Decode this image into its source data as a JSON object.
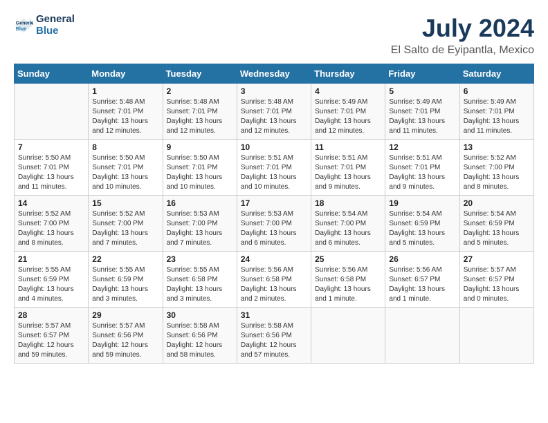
{
  "header": {
    "logo_line1": "General",
    "logo_line2": "Blue",
    "month": "July 2024",
    "location": "El Salto de Eyipantla, Mexico"
  },
  "weekdays": [
    "Sunday",
    "Monday",
    "Tuesday",
    "Wednesday",
    "Thursday",
    "Friday",
    "Saturday"
  ],
  "weeks": [
    [
      {
        "day": "",
        "info": ""
      },
      {
        "day": "1",
        "info": "Sunrise: 5:48 AM\nSunset: 7:01 PM\nDaylight: 13 hours\nand 12 minutes."
      },
      {
        "day": "2",
        "info": "Sunrise: 5:48 AM\nSunset: 7:01 PM\nDaylight: 13 hours\nand 12 minutes."
      },
      {
        "day": "3",
        "info": "Sunrise: 5:48 AM\nSunset: 7:01 PM\nDaylight: 13 hours\nand 12 minutes."
      },
      {
        "day": "4",
        "info": "Sunrise: 5:49 AM\nSunset: 7:01 PM\nDaylight: 13 hours\nand 12 minutes."
      },
      {
        "day": "5",
        "info": "Sunrise: 5:49 AM\nSunset: 7:01 PM\nDaylight: 13 hours\nand 11 minutes."
      },
      {
        "day": "6",
        "info": "Sunrise: 5:49 AM\nSunset: 7:01 PM\nDaylight: 13 hours\nand 11 minutes."
      }
    ],
    [
      {
        "day": "7",
        "info": "Sunrise: 5:50 AM\nSunset: 7:01 PM\nDaylight: 13 hours\nand 11 minutes."
      },
      {
        "day": "8",
        "info": "Sunrise: 5:50 AM\nSunset: 7:01 PM\nDaylight: 13 hours\nand 10 minutes."
      },
      {
        "day": "9",
        "info": "Sunrise: 5:50 AM\nSunset: 7:01 PM\nDaylight: 13 hours\nand 10 minutes."
      },
      {
        "day": "10",
        "info": "Sunrise: 5:51 AM\nSunset: 7:01 PM\nDaylight: 13 hours\nand 10 minutes."
      },
      {
        "day": "11",
        "info": "Sunrise: 5:51 AM\nSunset: 7:01 PM\nDaylight: 13 hours\nand 9 minutes."
      },
      {
        "day": "12",
        "info": "Sunrise: 5:51 AM\nSunset: 7:01 PM\nDaylight: 13 hours\nand 9 minutes."
      },
      {
        "day": "13",
        "info": "Sunrise: 5:52 AM\nSunset: 7:00 PM\nDaylight: 13 hours\nand 8 minutes."
      }
    ],
    [
      {
        "day": "14",
        "info": "Sunrise: 5:52 AM\nSunset: 7:00 PM\nDaylight: 13 hours\nand 8 minutes."
      },
      {
        "day": "15",
        "info": "Sunrise: 5:52 AM\nSunset: 7:00 PM\nDaylight: 13 hours\nand 7 minutes."
      },
      {
        "day": "16",
        "info": "Sunrise: 5:53 AM\nSunset: 7:00 PM\nDaylight: 13 hours\nand 7 minutes."
      },
      {
        "day": "17",
        "info": "Sunrise: 5:53 AM\nSunset: 7:00 PM\nDaylight: 13 hours\nand 6 minutes."
      },
      {
        "day": "18",
        "info": "Sunrise: 5:54 AM\nSunset: 7:00 PM\nDaylight: 13 hours\nand 6 minutes."
      },
      {
        "day": "19",
        "info": "Sunrise: 5:54 AM\nSunset: 6:59 PM\nDaylight: 13 hours\nand 5 minutes."
      },
      {
        "day": "20",
        "info": "Sunrise: 5:54 AM\nSunset: 6:59 PM\nDaylight: 13 hours\nand 5 minutes."
      }
    ],
    [
      {
        "day": "21",
        "info": "Sunrise: 5:55 AM\nSunset: 6:59 PM\nDaylight: 13 hours\nand 4 minutes."
      },
      {
        "day": "22",
        "info": "Sunrise: 5:55 AM\nSunset: 6:59 PM\nDaylight: 13 hours\nand 3 minutes."
      },
      {
        "day": "23",
        "info": "Sunrise: 5:55 AM\nSunset: 6:58 PM\nDaylight: 13 hours\nand 3 minutes."
      },
      {
        "day": "24",
        "info": "Sunrise: 5:56 AM\nSunset: 6:58 PM\nDaylight: 13 hours\nand 2 minutes."
      },
      {
        "day": "25",
        "info": "Sunrise: 5:56 AM\nSunset: 6:58 PM\nDaylight: 13 hours\nand 1 minute."
      },
      {
        "day": "26",
        "info": "Sunrise: 5:56 AM\nSunset: 6:57 PM\nDaylight: 13 hours\nand 1 minute."
      },
      {
        "day": "27",
        "info": "Sunrise: 5:57 AM\nSunset: 6:57 PM\nDaylight: 13 hours\nand 0 minutes."
      }
    ],
    [
      {
        "day": "28",
        "info": "Sunrise: 5:57 AM\nSunset: 6:57 PM\nDaylight: 12 hours\nand 59 minutes."
      },
      {
        "day": "29",
        "info": "Sunrise: 5:57 AM\nSunset: 6:56 PM\nDaylight: 12 hours\nand 59 minutes."
      },
      {
        "day": "30",
        "info": "Sunrise: 5:58 AM\nSunset: 6:56 PM\nDaylight: 12 hours\nand 58 minutes."
      },
      {
        "day": "31",
        "info": "Sunrise: 5:58 AM\nSunset: 6:56 PM\nDaylight: 12 hours\nand 57 minutes."
      },
      {
        "day": "",
        "info": ""
      },
      {
        "day": "",
        "info": ""
      },
      {
        "day": "",
        "info": ""
      }
    ]
  ]
}
